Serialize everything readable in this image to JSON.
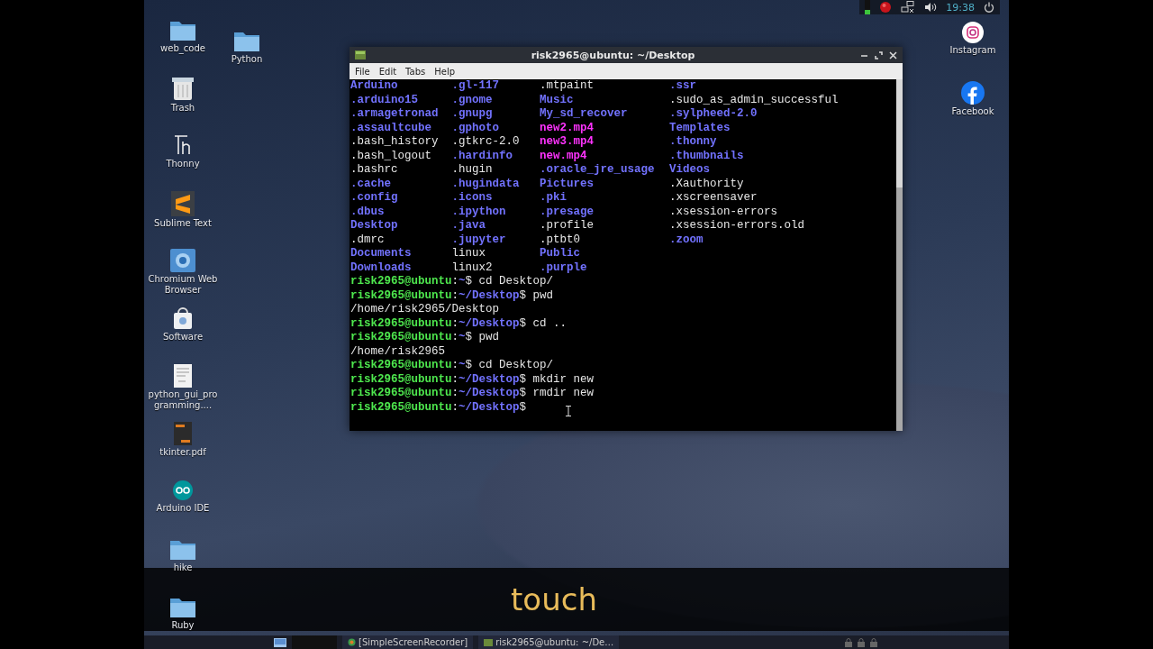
{
  "desktop_icons_left": [
    {
      "label": "web_code",
      "kind": "folder"
    },
    {
      "label": "Trash",
      "kind": "trash"
    },
    {
      "label": "Thonny",
      "kind": "thonny"
    },
    {
      "label": "Sublime Text",
      "kind": "sublime"
    },
    {
      "label": "Chromium Web Browser",
      "kind": "browser"
    },
    {
      "label": "Software",
      "kind": "software"
    },
    {
      "label": "python_gui_programming....",
      "kind": "document"
    },
    {
      "label": "tkinter.pdf",
      "kind": "pdf"
    },
    {
      "label": "Arduino IDE",
      "kind": "arduino"
    },
    {
      "label": "hike",
      "kind": "folder"
    },
    {
      "label": "Ruby",
      "kind": "folder"
    }
  ],
  "desktop_icons_second": [
    {
      "label": "Python",
      "kind": "folder"
    }
  ],
  "desktop_icons_right": [
    {
      "label": "Instagram",
      "kind": "instagram"
    },
    {
      "label": "Facebook",
      "kind": "facebook"
    }
  ],
  "tray": {
    "clock": "19:38"
  },
  "terminal": {
    "title": "risk2965@ubuntu: ~/Desktop",
    "menu": [
      "File",
      "Edit",
      "Tabs",
      "Help"
    ],
    "lines": [
      {
        "kind": "listing",
        "cells": [
          {
            "text": "Arduino",
            "kind": "dir"
          },
          {
            "text": ".gl-117",
            "kind": "dir"
          },
          {
            "text": ".mtpaint",
            "kind": "file"
          },
          {
            "text": ".ssr",
            "kind": "dir"
          }
        ]
      },
      {
        "kind": "listing",
        "cells": [
          {
            "text": ".arduino15",
            "kind": "dir"
          },
          {
            "text": ".gnome",
            "kind": "dir"
          },
          {
            "text": "Music",
            "kind": "dir"
          },
          {
            "text": ".sudo_as_admin_successful",
            "kind": "file"
          }
        ]
      },
      {
        "kind": "listing",
        "cells": [
          {
            "text": ".armagetronad",
            "kind": "dir"
          },
          {
            "text": ".gnupg",
            "kind": "dir"
          },
          {
            "text": "My_sd_recover",
            "kind": "dir"
          },
          {
            "text": ".sylpheed-2.0",
            "kind": "dir"
          }
        ]
      },
      {
        "kind": "listing",
        "cells": [
          {
            "text": ".assaultcube",
            "kind": "dir"
          },
          {
            "text": ".gphoto",
            "kind": "dir"
          },
          {
            "text": "new2.mp4",
            "kind": "media"
          },
          {
            "text": "Templates",
            "kind": "dir"
          }
        ]
      },
      {
        "kind": "listing",
        "cells": [
          {
            "text": ".bash_history",
            "kind": "file"
          },
          {
            "text": ".gtkrc-2.0",
            "kind": "file"
          },
          {
            "text": "new3.mp4",
            "kind": "media"
          },
          {
            "text": ".thonny",
            "kind": "dir"
          }
        ]
      },
      {
        "kind": "listing",
        "cells": [
          {
            "text": ".bash_logout",
            "kind": "file"
          },
          {
            "text": ".hardinfo",
            "kind": "dir"
          },
          {
            "text": "new.mp4",
            "kind": "media"
          },
          {
            "text": ".thumbnails",
            "kind": "dir"
          }
        ]
      },
      {
        "kind": "listing",
        "cells": [
          {
            "text": ".bashrc",
            "kind": "file"
          },
          {
            "text": ".hugin",
            "kind": "file"
          },
          {
            "text": ".oracle_jre_usage",
            "kind": "dir"
          },
          {
            "text": "Videos",
            "kind": "dir"
          }
        ]
      },
      {
        "kind": "listing",
        "cells": [
          {
            "text": ".cache",
            "kind": "dir"
          },
          {
            "text": ".hugindata",
            "kind": "dir"
          },
          {
            "text": "Pictures",
            "kind": "dir"
          },
          {
            "text": ".Xauthority",
            "kind": "file"
          }
        ]
      },
      {
        "kind": "listing",
        "cells": [
          {
            "text": ".config",
            "kind": "dir"
          },
          {
            "text": ".icons",
            "kind": "dir"
          },
          {
            "text": ".pki",
            "kind": "dir"
          },
          {
            "text": ".xscreensaver",
            "kind": "file"
          }
        ]
      },
      {
        "kind": "listing",
        "cells": [
          {
            "text": ".dbus",
            "kind": "dir"
          },
          {
            "text": ".ipython",
            "kind": "dir"
          },
          {
            "text": ".presage",
            "kind": "dir"
          },
          {
            "text": ".xsession-errors",
            "kind": "file"
          }
        ]
      },
      {
        "kind": "listing",
        "cells": [
          {
            "text": "Desktop",
            "kind": "dir"
          },
          {
            "text": ".java",
            "kind": "dir"
          },
          {
            "text": ".profile",
            "kind": "file"
          },
          {
            "text": ".xsession-errors.old",
            "kind": "file"
          }
        ]
      },
      {
        "kind": "listing",
        "cells": [
          {
            "text": ".dmrc",
            "kind": "file"
          },
          {
            "text": ".jupyter",
            "kind": "dir"
          },
          {
            "text": ".ptbt0",
            "kind": "file"
          },
          {
            "text": ".zoom",
            "kind": "dir"
          }
        ]
      },
      {
        "kind": "listing",
        "cells": [
          {
            "text": "Documents",
            "kind": "dir"
          },
          {
            "text": "linux",
            "kind": "file"
          },
          {
            "text": "Public",
            "kind": "dir"
          }
        ]
      },
      {
        "kind": "listing",
        "cells": [
          {
            "text": "Downloads",
            "kind": "dir"
          },
          {
            "text": "linux2",
            "kind": "file"
          },
          {
            "text": ".purple",
            "kind": "dir"
          }
        ]
      },
      {
        "kind": "prompt",
        "user": "risk2965@ubuntu",
        "separator": ":",
        "path": "~",
        "sign": "$",
        "command": " cd Desktop/"
      },
      {
        "kind": "prompt",
        "user": "risk2965@ubuntu",
        "separator": ":",
        "path": "~/Desktop",
        "sign": "$",
        "command": " pwd"
      },
      {
        "kind": "output",
        "text": "/home/risk2965/Desktop"
      },
      {
        "kind": "prompt",
        "user": "risk2965@ubuntu",
        "separator": ":",
        "path": "~/Desktop",
        "sign": "$",
        "command": " cd .."
      },
      {
        "kind": "prompt",
        "user": "risk2965@ubuntu",
        "separator": ":",
        "path": "~",
        "sign": "$",
        "command": " pwd"
      },
      {
        "kind": "output",
        "text": "/home/risk2965"
      },
      {
        "kind": "prompt",
        "user": "risk2965@ubuntu",
        "separator": ":",
        "path": "~",
        "sign": "$",
        "command": " cd Desktop/"
      },
      {
        "kind": "prompt",
        "user": "risk2965@ubuntu",
        "separator": ":",
        "path": "~/Desktop",
        "sign": "$",
        "command": " mkdir new"
      },
      {
        "kind": "prompt",
        "user": "risk2965@ubuntu",
        "separator": ":",
        "path": "~/Desktop",
        "sign": "$",
        "command": " rmdir new"
      },
      {
        "kind": "prompt",
        "user": "risk2965@ubuntu",
        "separator": ":",
        "path": "~/Desktop",
        "sign": "$"
      }
    ]
  },
  "caption": "touch",
  "taskbar": {
    "tasks": [
      {
        "label": "[SimpleScreenRecorder]",
        "kind": "recorder"
      },
      {
        "label": "risk2965@ubuntu: ~/De…",
        "kind": "terminal"
      }
    ]
  }
}
